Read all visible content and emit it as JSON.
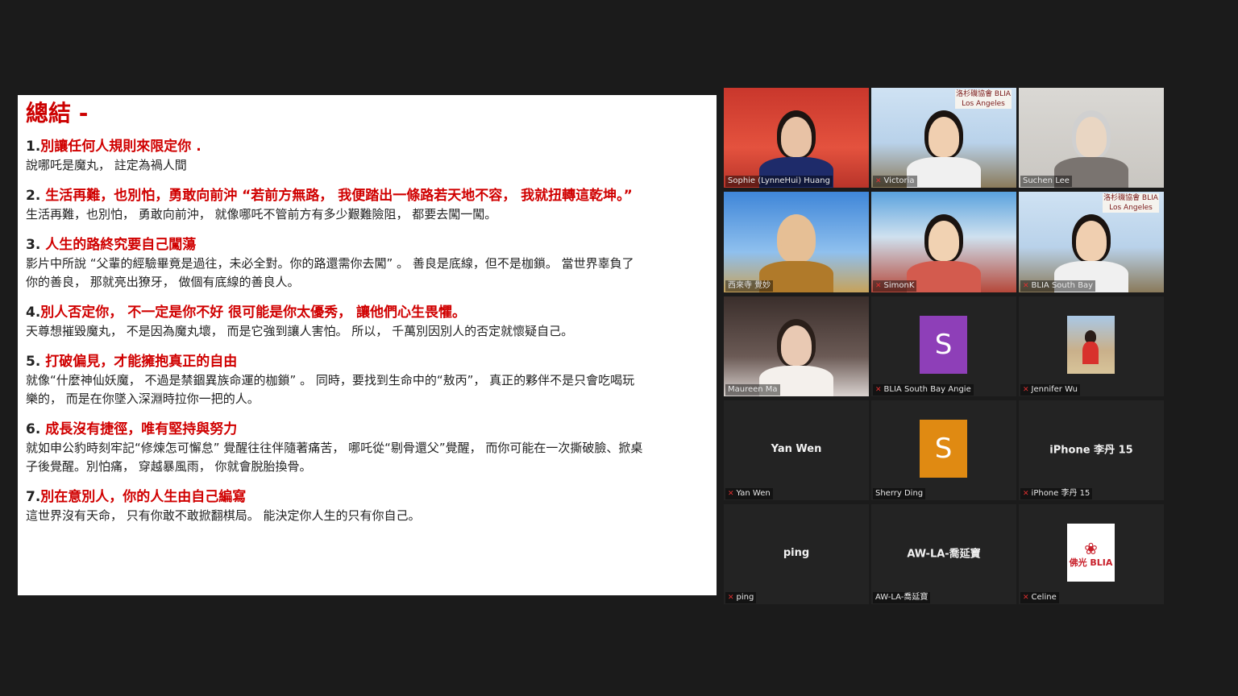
{
  "slide": {
    "title": "總結 -",
    "sections": [
      {
        "num": "1.",
        "heading": "別讓任何人規則來限定你 .",
        "body": "    說哪吒是魔丸，  註定為禍人間"
      },
      {
        "num": " 2. ",
        "heading": "生活再難，也別怕，勇敢向前沖 “若前方無路，  我便踏出一條路若天地不容，  我就扭轉這乾坤。”",
        "body": "生活再難，也別怕，  勇敢向前沖，  就像哪吒不管前方有多少艱難險阻，  都要去闖一闖。"
      },
      {
        "num": "3. ",
        "heading": "人生的路終究要自己闖蕩",
        "body": "影片中所說 “父輩的經驗畢竟是過往，未必全對。你的路還需你去闖” 。 善良是底線，但不是枷鎖。 當世界辜負了\n你的善良，  那就亮出獠牙，  做個有底線的善良人。"
      },
      {
        "num": "4.",
        "heading": "別人否定你，  不一定是你不好 很可能是你太優秀，  讓他們心生畏懼。",
        "body": "天尊想摧毀魔丸，  不是因為魔丸壞，  而是它強到讓人害怕。 所以，  千萬別因別人的否定就懷疑自己。"
      },
      {
        "num": " 5. ",
        "heading": "打破偏見，才能擁抱真正的自由",
        "body": "就像“什麼神仙妖魔，  不過是禁錮異族命運的枷鎖” 。 同時，要找到生命中的“敖丙”，  真正的夥伴不是只會吃喝玩\n樂的，  而是在你墜入深淵時拉你一把的人。"
      },
      {
        "num": " 6. ",
        "heading": "成長沒有捷徑，唯有堅持與努力",
        "body": "就如申公豹時刻牢記“修煉怎可懈怠” 覺醒往往伴隨著痛苦，  哪吒從“剔骨還父”覺醒，  而你可能在一次撕破臉、掀桌\n子後覺醒。別怕痛，  穿越暴風雨，  你就會脫胎換骨。"
      },
      {
        "num": " 7.",
        "heading": "別在意別人，你的人生由自己編寫",
        "body": "這世界沒有天命，  只有你敢不敢掀翻棋局。 能決定你人生的只有你自己。"
      }
    ]
  },
  "participants": [
    {
      "name": "Sophie (LynneHui) Huang",
      "muted": false,
      "kind": "video",
      "scene": "red-room"
    },
    {
      "name": "Victoria",
      "muted": true,
      "kind": "video",
      "scene": "gate",
      "banner": "洛杉磯協會 BLIA Los Angeles"
    },
    {
      "name": "Suchen Lee",
      "muted": false,
      "kind": "video",
      "scene": "grey-room"
    },
    {
      "name": "西來寺 覺妙",
      "muted": false,
      "kind": "video",
      "scene": "sky",
      "active": true
    },
    {
      "name": "SimonK",
      "muted": true,
      "kind": "video",
      "scene": "sea"
    },
    {
      "name": "BLIA South Bay",
      "muted": true,
      "kind": "video",
      "scene": "gate",
      "banner": "洛杉磯協會 BLIA Los Angeles"
    },
    {
      "name": "Maureen Ma",
      "muted": false,
      "kind": "video",
      "scene": "indoor"
    },
    {
      "name": "BLIA South Bay Angie",
      "muted": true,
      "kind": "avatar",
      "letter": "S",
      "color": "#8e3fb8"
    },
    {
      "name": "Jennifer Wu",
      "muted": true,
      "kind": "photo"
    },
    {
      "name": "Yan Wen",
      "muted": true,
      "kind": "name",
      "display": "Yan Wen"
    },
    {
      "name": "Sherry Ding",
      "muted": false,
      "kind": "avatar",
      "letter": "S",
      "color": "#e08a12"
    },
    {
      "name": "iPhone 李丹 15",
      "muted": true,
      "kind": "name",
      "display": "iPhone 李丹 15"
    },
    {
      "name": "ping",
      "muted": true,
      "kind": "name",
      "display": "ping"
    },
    {
      "name": "AW-LA-喬延寶",
      "muted": false,
      "kind": "name",
      "display": "AW-LA-喬延寶"
    },
    {
      "name": "Celine",
      "muted": true,
      "kind": "logo",
      "logo_text": "佛光 BLIA"
    }
  ],
  "icons": {
    "mic_muted": "mic-muted-icon"
  },
  "colors": {
    "heading_red": "#d00000",
    "active_speaker": "#e6e337",
    "background": "#1b1b1b"
  }
}
